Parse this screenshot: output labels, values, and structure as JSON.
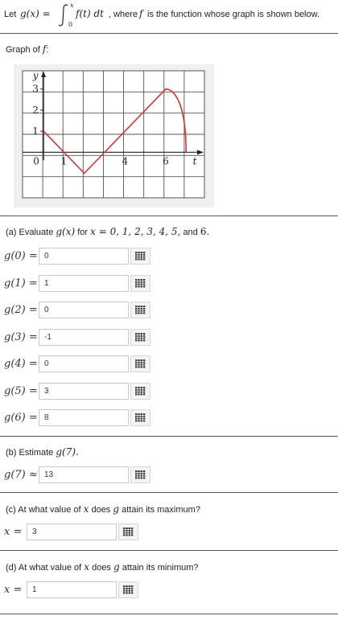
{
  "intro": {
    "let": "Let",
    "g_def": "g(x) =",
    "upper": "x",
    "lower": "0",
    "integrand": "f(t) dt",
    "tail": ", where",
    "f": "f",
    "tail2": "is the function whose graph is shown below."
  },
  "graph_caption": {
    "text": "Graph of",
    "f": "f",
    "colon": ":"
  },
  "graph": {
    "line_color": "#e03030",
    "y_axis_label": "y",
    "x_axis_label": "t",
    "y_ticks": [
      "3",
      "2",
      "1"
    ],
    "x_ticks": [
      "0",
      "1",
      "4",
      "6"
    ],
    "points": [
      [
        0,
        1
      ],
      [
        2,
        -1
      ],
      [
        6,
        3
      ],
      [
        7,
        0
      ]
    ]
  },
  "part_a": {
    "prompt_start": "(a) Evaluate",
    "g": "g(x)",
    "for": "for",
    "x_eq": "x = 0, 1, 2, 3, 4, 5,",
    "and": "and",
    "six": "6.",
    "rows": [
      {
        "label": "g(0) =",
        "value": "0"
      },
      {
        "label": "g(1) =",
        "value": "1"
      },
      {
        "label": "g(2) =",
        "value": "0"
      },
      {
        "label": "g(3) =",
        "value": "-1"
      },
      {
        "label": "g(4) =",
        "value": "0"
      },
      {
        "label": "g(5) =",
        "value": "3"
      },
      {
        "label": "g(6) =",
        "value": "8"
      }
    ]
  },
  "part_b": {
    "prompt_start": "(b) Estimate",
    "g7": "g(7).",
    "label": "g(7) ≈",
    "value": "13"
  },
  "part_c": {
    "prompt_start": "(c) At what value of",
    "x": "x",
    "does": "does",
    "g": "g",
    "tail": "attain its maximum?",
    "label": "x =",
    "value": "3"
  },
  "part_d": {
    "prompt_start": "(d) At what value of",
    "x": "x",
    "does": "does",
    "g": "g",
    "tail": "attain its minimum?",
    "label": "x =",
    "value": "1"
  },
  "keypad_icon": "keypad-icon"
}
